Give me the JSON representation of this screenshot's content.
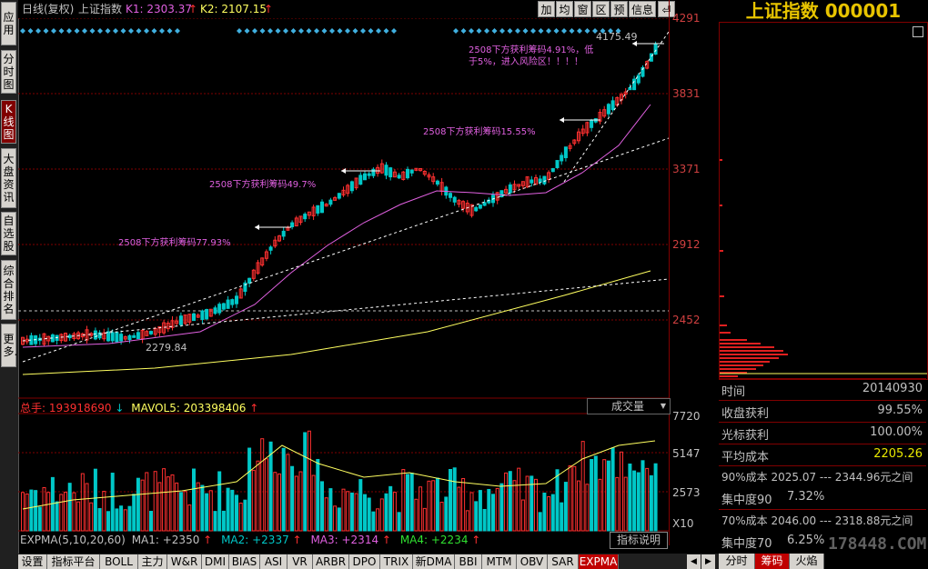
{
  "leftnav": [
    {
      "label": "应用",
      "active": false
    },
    {
      "label": "分时图",
      "active": false
    },
    {
      "label": "K线图",
      "active": true
    },
    {
      "label": "大盘资讯",
      "active": false
    },
    {
      "label": "自选股",
      "active": false
    },
    {
      "label": "综合排名",
      "active": false
    },
    {
      "label": "更多.",
      "active": false
    }
  ],
  "header": {
    "period": "日线(复权)",
    "index_name": "上证指数",
    "k1_label": "K1: 2303.37",
    "k2_label": "K2: 2107.15",
    "arrow_up": "↑",
    "buttons": [
      "加",
      "均",
      "窗",
      "区",
      "预",
      "信息"
    ],
    "exit_icon": "⏎"
  },
  "price_axis": [
    "4291",
    "3831",
    "3371",
    "2912",
    "2452"
  ],
  "annotations": {
    "a1": "2508下方获利筹码77.93%",
    "a2": "2508下方获利筹码49.7%",
    "a3": "2508下方获利筹码15.55%",
    "a4a": "2508下方获利筹码4.91%，低",
    "a4b": "于5%，进入风险区！！！！",
    "low_label": "2279.84",
    "high_label": "4175.49"
  },
  "volume": {
    "total": "总手: 193918690",
    "down_arrow": "↓",
    "mavol": "MAVOL5: 203398406",
    "dropdown": "成交量",
    "dropdown_icon": "▼",
    "axis": [
      "7720",
      "5147",
      "2573",
      "X10"
    ]
  },
  "expma": {
    "label": "EXPMA(5,10,20,60)",
    "ma1": "MA1: +2350",
    "ma2": "MA2: +2337",
    "ma3": "MA3: +2314",
    "ma4": "MA4: +2234",
    "up": "↑",
    "indicator_help": "指标说明"
  },
  "bottom_tabs": [
    "设置",
    "指标平台",
    "BOLL",
    "主力",
    "W&R",
    "DMI",
    "BIAS",
    "ASI",
    "VR",
    "ARBR",
    "DPO",
    "TRIX",
    "新DMA",
    "BBI",
    "MTM",
    "OBV",
    "SAR",
    "EXPMA"
  ],
  "bottom_active": "EXPMA",
  "right_panel": {
    "title": "上证指数 000001",
    "rows": [
      {
        "label": "时间",
        "value": "20140930"
      },
      {
        "label": "收盘获利",
        "value": "99.55%"
      },
      {
        "label": "光标获利",
        "value": "100.00%"
      },
      {
        "label": "平均成本",
        "value": "2205.26"
      }
    ],
    "cost90": "90%成本  2025.07 --- 2344.96元之间",
    "conc90_label": "集中度90",
    "conc90_value": "7.32%",
    "cost70": "70%成本  2046.00 --- 2318.88元之间",
    "conc70_label": "集中度70",
    "conc70_value": "6.25%",
    "tabs": [
      "分时",
      "筹码",
      "火焰"
    ],
    "active_tab": "筹码",
    "watermark": "178448.COM"
  },
  "colors": {
    "up": "#ff3030",
    "down": "#00c8c8",
    "ma_pink": "#e060e0",
    "ma_yellow": "#ffff60",
    "grid": "#800000"
  }
}
